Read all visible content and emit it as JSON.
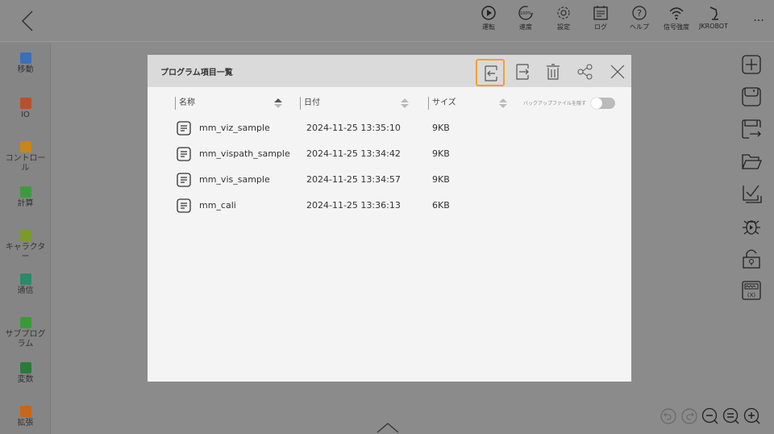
{
  "topbar": {
    "items": [
      {
        "icon": "play-circle-icon",
        "label": "運転"
      },
      {
        "icon": "speed-gauge-icon",
        "label": "速度",
        "badge": "100%"
      },
      {
        "icon": "gear-icon",
        "label": "設定"
      },
      {
        "icon": "log-icon",
        "label": "ログ"
      },
      {
        "icon": "help-icon",
        "label": "ヘルプ"
      },
      {
        "icon": "wifi-icon",
        "label": "信号強度"
      },
      {
        "icon": "robot-arm-icon",
        "label": "JKROBOT"
      }
    ],
    "more": "..."
  },
  "sidebar": {
    "items": [
      {
        "label": "移動",
        "color": "#3b6fb6"
      },
      {
        "label": "IO",
        "color": "#b8502e"
      },
      {
        "label": "コントロール",
        "color": "#c8861a"
      },
      {
        "label": "計算",
        "color": "#3f9a3f"
      },
      {
        "label": "キャラクター",
        "color": "#7a9a2a"
      },
      {
        "label": "通信",
        "color": "#2a8a6a"
      },
      {
        "label": "サブプログラム",
        "color": "#3a9a3a"
      },
      {
        "label": "変数",
        "color": "#2a7a3a"
      },
      {
        "label": "拡張",
        "color": "#c8661a"
      }
    ]
  },
  "dialog": {
    "title": "プログラム項目一覧",
    "columns": {
      "name": "名称",
      "date": "日付",
      "size": "サイズ"
    },
    "toggle_label": "バックアップファイルを隠す",
    "toggle_on": false,
    "accent": "#f0a030",
    "rows": [
      {
        "name": "mm_viz_sample",
        "date": "2024-11-25 13:35:10",
        "size": "9KB"
      },
      {
        "name": "mm_vispath_sample",
        "date": "2024-11-25 13:34:42",
        "size": "9KB"
      },
      {
        "name": "mm_vis_sample",
        "date": "2024-11-25 13:34:57",
        "size": "9KB"
      },
      {
        "name": "mm_cali",
        "date": "2024-11-25 13:36:13",
        "size": "6KB"
      }
    ]
  }
}
